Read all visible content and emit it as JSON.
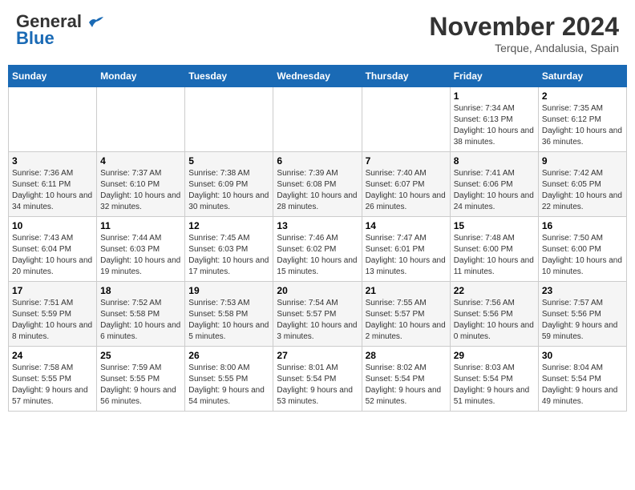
{
  "header": {
    "logo_general": "General",
    "logo_blue": "Blue",
    "month": "November 2024",
    "location": "Terque, Andalusia, Spain"
  },
  "days_of_week": [
    "Sunday",
    "Monday",
    "Tuesday",
    "Wednesday",
    "Thursday",
    "Friday",
    "Saturday"
  ],
  "weeks": [
    [
      {
        "day": "",
        "info": ""
      },
      {
        "day": "",
        "info": ""
      },
      {
        "day": "",
        "info": ""
      },
      {
        "day": "",
        "info": ""
      },
      {
        "day": "",
        "info": ""
      },
      {
        "day": "1",
        "info": "Sunrise: 7:34 AM\nSunset: 6:13 PM\nDaylight: 10 hours and 38 minutes."
      },
      {
        "day": "2",
        "info": "Sunrise: 7:35 AM\nSunset: 6:12 PM\nDaylight: 10 hours and 36 minutes."
      }
    ],
    [
      {
        "day": "3",
        "info": "Sunrise: 7:36 AM\nSunset: 6:11 PM\nDaylight: 10 hours and 34 minutes."
      },
      {
        "day": "4",
        "info": "Sunrise: 7:37 AM\nSunset: 6:10 PM\nDaylight: 10 hours and 32 minutes."
      },
      {
        "day": "5",
        "info": "Sunrise: 7:38 AM\nSunset: 6:09 PM\nDaylight: 10 hours and 30 minutes."
      },
      {
        "day": "6",
        "info": "Sunrise: 7:39 AM\nSunset: 6:08 PM\nDaylight: 10 hours and 28 minutes."
      },
      {
        "day": "7",
        "info": "Sunrise: 7:40 AM\nSunset: 6:07 PM\nDaylight: 10 hours and 26 minutes."
      },
      {
        "day": "8",
        "info": "Sunrise: 7:41 AM\nSunset: 6:06 PM\nDaylight: 10 hours and 24 minutes."
      },
      {
        "day": "9",
        "info": "Sunrise: 7:42 AM\nSunset: 6:05 PM\nDaylight: 10 hours and 22 minutes."
      }
    ],
    [
      {
        "day": "10",
        "info": "Sunrise: 7:43 AM\nSunset: 6:04 PM\nDaylight: 10 hours and 20 minutes."
      },
      {
        "day": "11",
        "info": "Sunrise: 7:44 AM\nSunset: 6:03 PM\nDaylight: 10 hours and 19 minutes."
      },
      {
        "day": "12",
        "info": "Sunrise: 7:45 AM\nSunset: 6:03 PM\nDaylight: 10 hours and 17 minutes."
      },
      {
        "day": "13",
        "info": "Sunrise: 7:46 AM\nSunset: 6:02 PM\nDaylight: 10 hours and 15 minutes."
      },
      {
        "day": "14",
        "info": "Sunrise: 7:47 AM\nSunset: 6:01 PM\nDaylight: 10 hours and 13 minutes."
      },
      {
        "day": "15",
        "info": "Sunrise: 7:48 AM\nSunset: 6:00 PM\nDaylight: 10 hours and 11 minutes."
      },
      {
        "day": "16",
        "info": "Sunrise: 7:50 AM\nSunset: 6:00 PM\nDaylight: 10 hours and 10 minutes."
      }
    ],
    [
      {
        "day": "17",
        "info": "Sunrise: 7:51 AM\nSunset: 5:59 PM\nDaylight: 10 hours and 8 minutes."
      },
      {
        "day": "18",
        "info": "Sunrise: 7:52 AM\nSunset: 5:58 PM\nDaylight: 10 hours and 6 minutes."
      },
      {
        "day": "19",
        "info": "Sunrise: 7:53 AM\nSunset: 5:58 PM\nDaylight: 10 hours and 5 minutes."
      },
      {
        "day": "20",
        "info": "Sunrise: 7:54 AM\nSunset: 5:57 PM\nDaylight: 10 hours and 3 minutes."
      },
      {
        "day": "21",
        "info": "Sunrise: 7:55 AM\nSunset: 5:57 PM\nDaylight: 10 hours and 2 minutes."
      },
      {
        "day": "22",
        "info": "Sunrise: 7:56 AM\nSunset: 5:56 PM\nDaylight: 10 hours and 0 minutes."
      },
      {
        "day": "23",
        "info": "Sunrise: 7:57 AM\nSunset: 5:56 PM\nDaylight: 9 hours and 59 minutes."
      }
    ],
    [
      {
        "day": "24",
        "info": "Sunrise: 7:58 AM\nSunset: 5:55 PM\nDaylight: 9 hours and 57 minutes."
      },
      {
        "day": "25",
        "info": "Sunrise: 7:59 AM\nSunset: 5:55 PM\nDaylight: 9 hours and 56 minutes."
      },
      {
        "day": "26",
        "info": "Sunrise: 8:00 AM\nSunset: 5:55 PM\nDaylight: 9 hours and 54 minutes."
      },
      {
        "day": "27",
        "info": "Sunrise: 8:01 AM\nSunset: 5:54 PM\nDaylight: 9 hours and 53 minutes."
      },
      {
        "day": "28",
        "info": "Sunrise: 8:02 AM\nSunset: 5:54 PM\nDaylight: 9 hours and 52 minutes."
      },
      {
        "day": "29",
        "info": "Sunrise: 8:03 AM\nSunset: 5:54 PM\nDaylight: 9 hours and 51 minutes."
      },
      {
        "day": "30",
        "info": "Sunrise: 8:04 AM\nSunset: 5:54 PM\nDaylight: 9 hours and 49 minutes."
      }
    ]
  ]
}
